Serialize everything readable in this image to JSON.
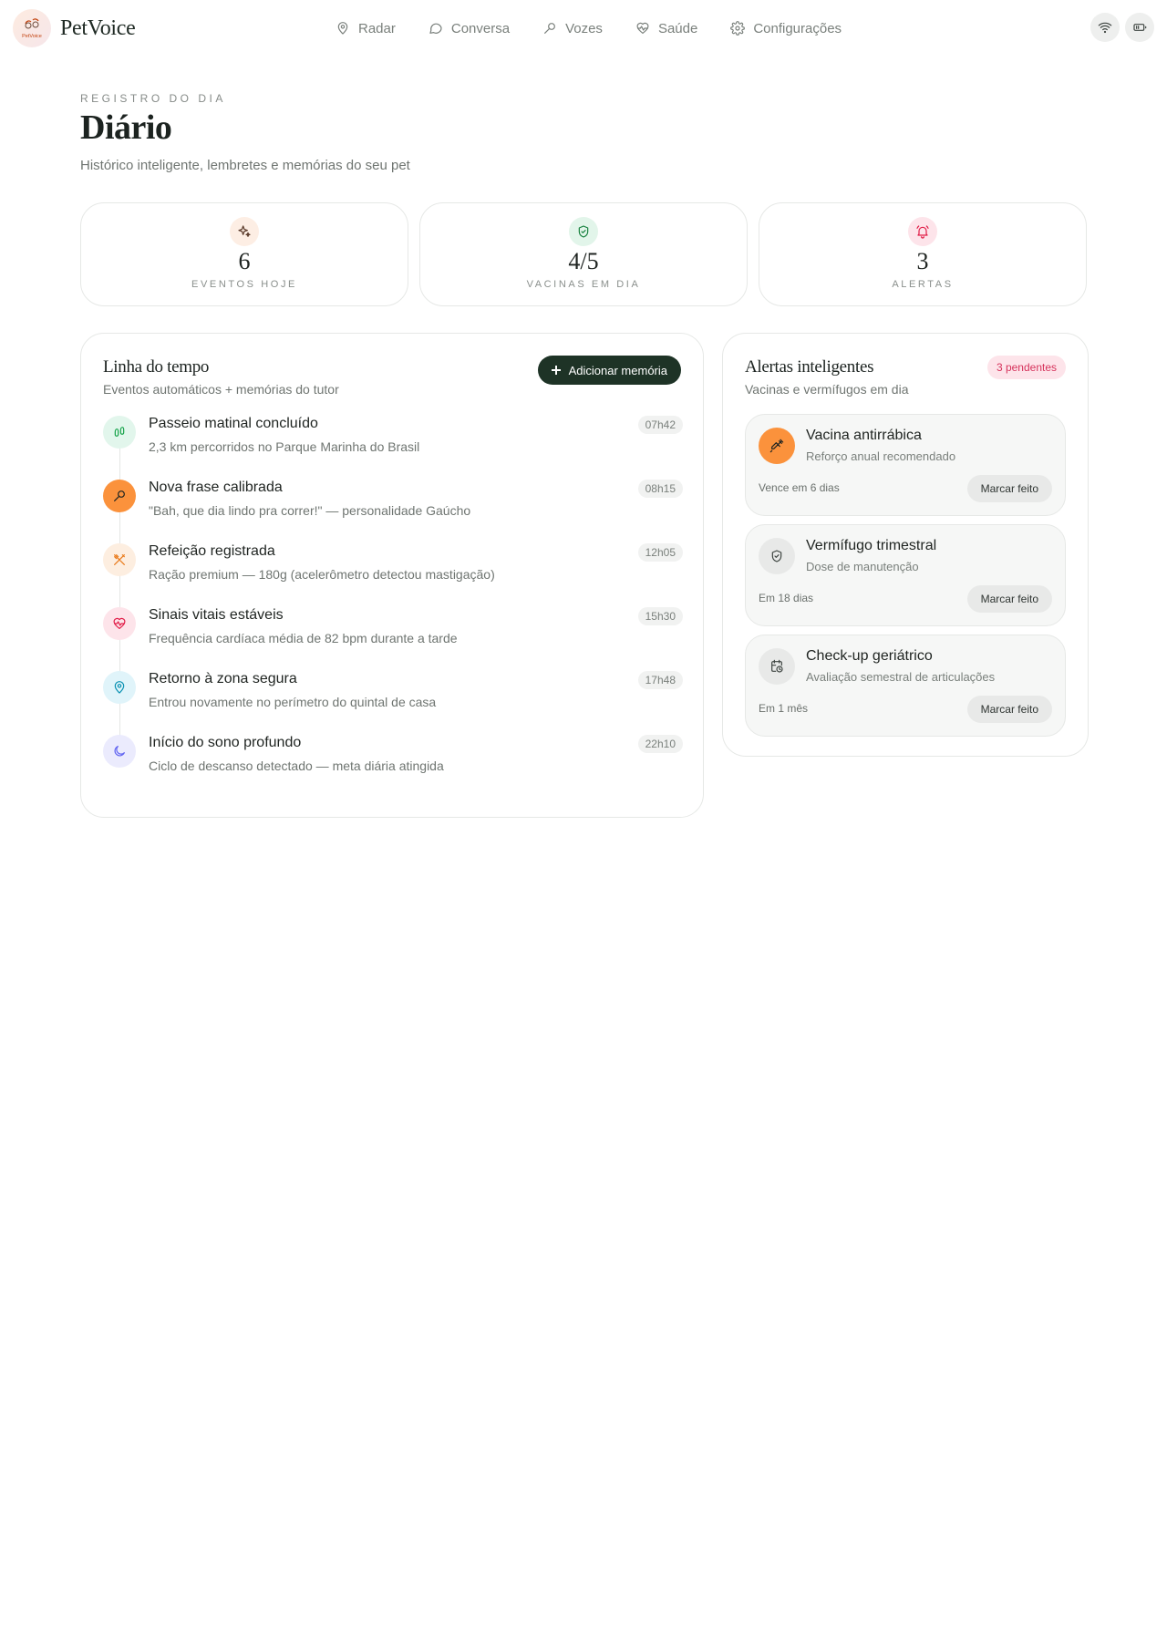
{
  "header": {
    "brand": "PetVoice",
    "logo_text": "PetVoice",
    "nav": [
      {
        "label": "Radar",
        "icon": "map-pin-icon"
      },
      {
        "label": "Conversa",
        "icon": "chat-bubble-icon"
      },
      {
        "label": "Vozes",
        "icon": "microphone-icon"
      },
      {
        "label": "Saúde",
        "icon": "heart-pulse-icon"
      },
      {
        "label": "Configurações",
        "icon": "gear-icon"
      }
    ],
    "actions": [
      {
        "icon": "wifi-icon"
      },
      {
        "icon": "battery-icon"
      }
    ]
  },
  "page": {
    "eyebrow": "REGISTRO DO DIA",
    "title": "Diário",
    "subtitle": "Histórico inteligente, lembretes e memórias do seu pet"
  },
  "stats": [
    {
      "value": "6",
      "label": "EVENTOS HOJE",
      "icon": "sparkles-icon",
      "color": "#c2410c",
      "bg": "#fdeee4"
    },
    {
      "value": "4/5",
      "label": "VACINAS EM DIA",
      "icon": "shield-check-icon",
      "color": "#15803d",
      "bg": "#e2f5ea"
    },
    {
      "value": "3",
      "label": "ALERTAS",
      "icon": "bell-ring-icon",
      "color": "#e11d48",
      "bg": "#fde4ea"
    }
  ],
  "timeline": {
    "title": "Linha do tempo",
    "subtitle": "Eventos automáticos + memórias do tutor",
    "add_button": "Adicionar memória",
    "items": [
      {
        "title": "Passeio matinal concluído",
        "desc": "2,3 km percorridos no Parque Marinha do Brasil",
        "time": "07h42",
        "icon": "footprints-icon",
        "color": "#16a34a",
        "bg": "#e2f6ec"
      },
      {
        "title": "Nova frase calibrada",
        "desc": "\"Bah, que dia lindo pra correr!\" — personalidade Gaúcho",
        "time": "08h15",
        "icon": "microphone-icon",
        "color": "#1f2421",
        "bg": "#fb923c"
      },
      {
        "title": "Refeição registrada",
        "desc": "Ração premium — 180g (acelerômetro detectou mastigação)",
        "time": "12h05",
        "icon": "utensils-icon",
        "color": "#ea7a1a",
        "bg": "#fdeee0"
      },
      {
        "title": "Sinais vitais estáveis",
        "desc": "Frequência cardíaca média de 82 bpm durante a tarde",
        "time": "15h30",
        "icon": "heart-pulse-icon",
        "color": "#e11d48",
        "bg": "#fde4ea"
      },
      {
        "title": "Retorno à zona segura",
        "desc": "Entrou novamente no perímetro do quintal de casa",
        "time": "17h48",
        "icon": "map-pin-icon",
        "color": "#0891b2",
        "bg": "#e0f4fa"
      },
      {
        "title": "Início do sono profundo",
        "desc": "Ciclo de descanso detectado — meta diária atingida",
        "time": "22h10",
        "icon": "moon-icon",
        "color": "#6366f1",
        "bg": "#ebebfd"
      }
    ]
  },
  "alerts": {
    "title": "Alertas inteligentes",
    "subtitle": "Vacinas e vermífugos em dia",
    "badge": "3 pendentes",
    "items": [
      {
        "title": "Vacina antirrábica",
        "desc": "Reforço anual recomendado",
        "due": "Vence em 6 dias",
        "button": "Marcar feito",
        "icon": "syringe-icon",
        "color": "#1f2421",
        "bg": "#fb923c"
      },
      {
        "title": "Vermífugo trimestral",
        "desc": "Dose de manutenção",
        "due": "Em 18 dias",
        "button": "Marcar feito",
        "icon": "shield-check-icon",
        "color": "#3d4440",
        "bg": "#e8e9e8"
      },
      {
        "title": "Check-up geriátrico",
        "desc": "Avaliação semestral de articulações",
        "due": "Em 1 mês",
        "button": "Marcar feito",
        "icon": "calendar-clock-icon",
        "color": "#3d4440",
        "bg": "#e8e9e8"
      }
    ]
  }
}
